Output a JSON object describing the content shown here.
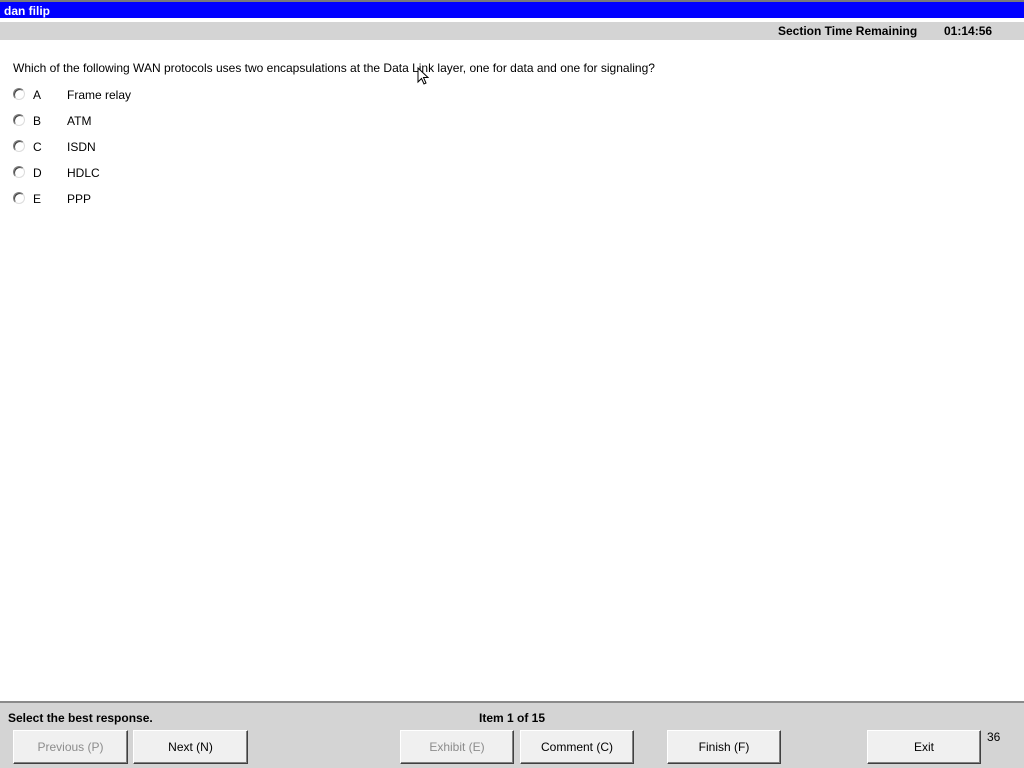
{
  "window": {
    "title": "dan filip"
  },
  "timer": {
    "label": "Section Time Remaining",
    "value": "01:14:56"
  },
  "question": {
    "text": "Which of the following WAN protocols uses two encapsulations at the Data Link layer, one for data and one for signaling?",
    "options": [
      {
        "letter": "A",
        "text": "Frame relay",
        "selected": false
      },
      {
        "letter": "B",
        "text": "ATM",
        "selected": false
      },
      {
        "letter": "C",
        "text": "ISDN",
        "selected": false
      },
      {
        "letter": "D",
        "text": "HDLC",
        "selected": false
      },
      {
        "letter": "E",
        "text": "PPP",
        "selected": false
      }
    ]
  },
  "footer": {
    "instruction": "Select the best response.",
    "item_counter": "Item 1 of 15",
    "page_number": "36",
    "buttons": {
      "previous": "Previous (P)",
      "next": "Next (N)",
      "exhibit": "Exhibit (E)",
      "comment": "Comment (C)",
      "finish": "Finish (F)",
      "exit": "Exit"
    }
  }
}
